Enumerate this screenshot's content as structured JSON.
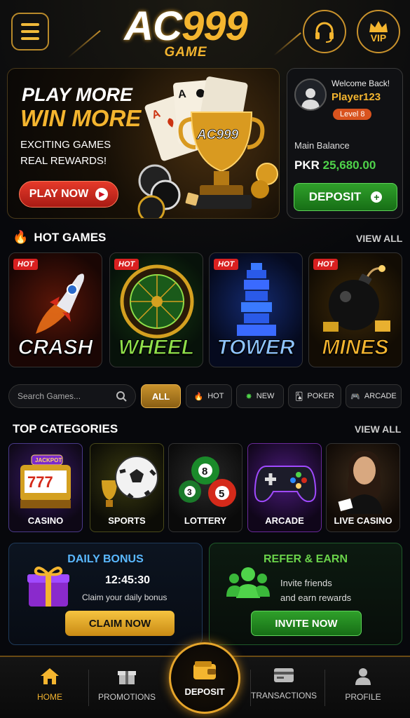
{
  "header": {
    "logo_main_white": "AC",
    "logo_main_gold": "999",
    "logo_sub": "GAME",
    "vip_label": "VIP"
  },
  "hero": {
    "line1": "PLAY MORE",
    "line2": "WIN MORE",
    "sub1": "EXCITING GAMES",
    "sub2": "REAL REWARDS!",
    "play_label": "PLAY NOW",
    "trophy_text": "AC999"
  },
  "account": {
    "welcome": "Welcome Back!",
    "username": "Player123",
    "level": "Level 8",
    "balance_label": "Main Balance",
    "currency": "PKR",
    "balance": "25,680.00",
    "deposit_label": "DEPOSIT"
  },
  "hot_games": {
    "title": "HOT GAMES",
    "view_all": "VIEW ALL",
    "badge": "HOT",
    "items": [
      {
        "name": "CRASH",
        "color": "#ffffff"
      },
      {
        "name": "WHEEL",
        "color": "#8fe04a"
      },
      {
        "name": "TOWER",
        "color": "#8fc4ff"
      },
      {
        "name": "MINES",
        "color": "#f4b52f"
      }
    ]
  },
  "filters": {
    "search_placeholder": "Search Games...",
    "chips": [
      "ALL",
      "HOT",
      "NEW",
      "POKER",
      "ARCADE"
    ]
  },
  "categories": {
    "title": "TOP CATEGORIES",
    "view_all": "VIEW ALL",
    "jackpot": "JACKPOT",
    "items": [
      "CASINO",
      "SPORTS",
      "LOTTERY",
      "ARCADE",
      "LIVE CASINO"
    ]
  },
  "daily_bonus": {
    "title": "DAILY BONUS",
    "timer": "12:45:30",
    "desc": "Claim your daily bonus",
    "button": "CLAIM NOW"
  },
  "refer": {
    "title": "REFER & EARN",
    "line1": "Invite friends",
    "line2": "and earn rewards",
    "button": "INVITE NOW"
  },
  "bottom_nav": {
    "home": "HOME",
    "promotions": "PROMOTIONS",
    "deposit": "DEPOSIT",
    "transactions": "TRANSACTIONS",
    "profile": "PROFILE"
  },
  "colors": {
    "gold": "#f4b52f",
    "green": "#4fd34a",
    "red": "#d92020",
    "bg": "#07080c"
  }
}
